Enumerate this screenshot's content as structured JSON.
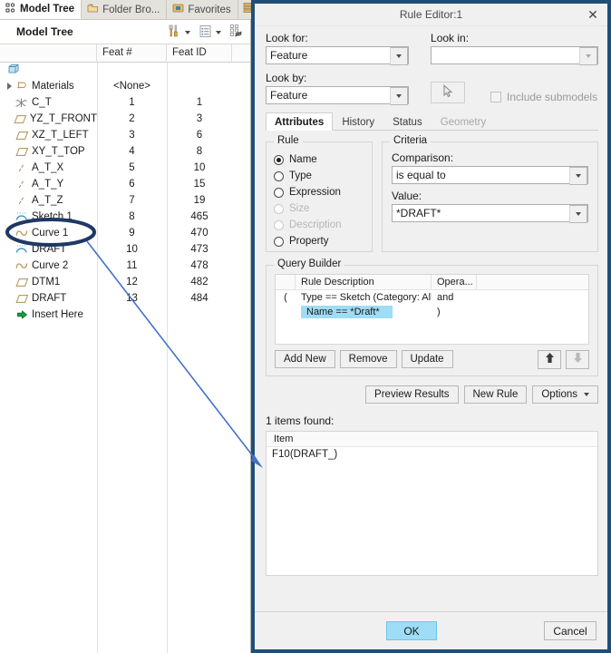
{
  "model_tree": {
    "tabs": [
      {
        "label": "Model Tree",
        "icon": "model-tree-icon",
        "active": true
      },
      {
        "label": "Folder Bro...",
        "icon": "folder-browser-icon",
        "active": false
      },
      {
        "label": "Favorites",
        "icon": "favorites-icon",
        "active": false
      },
      {
        "label": "",
        "icon": "layers-search-icon",
        "active": false
      }
    ],
    "header_title": "Model Tree",
    "toolbar": [
      {
        "name": "settings-tools-icon",
        "has_caret": true
      },
      {
        "name": "tree-filters-icon",
        "has_caret": true
      },
      {
        "name": "show-hide-icon",
        "has_caret": false
      }
    ],
    "columns": [
      "",
      "Feat #",
      "Feat ID",
      ""
    ],
    "rows": [
      {
        "label": "Materials",
        "icon": "materials-icon",
        "feat_num": "<None>",
        "feat_id": "",
        "expander": true,
        "indent": 0
      },
      {
        "label": "C_T",
        "icon": "coordinate-system-icon",
        "feat_num": "1",
        "feat_id": "1",
        "expander": false,
        "indent": 1
      },
      {
        "label": "YZ_T_FRONT",
        "icon": "datum-plane-icon",
        "feat_num": "2",
        "feat_id": "3",
        "expander": false,
        "indent": 1
      },
      {
        "label": "XZ_T_LEFT",
        "icon": "datum-plane-icon",
        "feat_num": "3",
        "feat_id": "6",
        "expander": false,
        "indent": 1
      },
      {
        "label": "XY_T_TOP",
        "icon": "datum-plane-icon",
        "feat_num": "4",
        "feat_id": "8",
        "expander": false,
        "indent": 1
      },
      {
        "label": "A_T_X",
        "icon": "datum-axis-icon",
        "feat_num": "5",
        "feat_id": "10",
        "expander": false,
        "indent": 1
      },
      {
        "label": "A_T_Y",
        "icon": "datum-axis-icon",
        "feat_num": "6",
        "feat_id": "15",
        "expander": false,
        "indent": 1
      },
      {
        "label": "A_T_Z",
        "icon": "datum-axis-icon",
        "feat_num": "7",
        "feat_id": "19",
        "expander": false,
        "indent": 1
      },
      {
        "label": "Sketch 1",
        "icon": "sketch-icon",
        "feat_num": "8",
        "feat_id": "465",
        "expander": false,
        "indent": 1
      },
      {
        "label": "Curve 1",
        "icon": "curve-icon",
        "feat_num": "9",
        "feat_id": "470",
        "expander": false,
        "indent": 1
      },
      {
        "label": "DRAFT",
        "icon": "sketch-icon",
        "feat_num": "10",
        "feat_id": "473",
        "expander": false,
        "indent": 1,
        "highlighted": true
      },
      {
        "label": "Curve 2",
        "icon": "curve-icon",
        "feat_num": "11",
        "feat_id": "478",
        "expander": false,
        "indent": 1
      },
      {
        "label": "DTM1",
        "icon": "datum-plane-icon",
        "feat_num": "12",
        "feat_id": "482",
        "expander": false,
        "indent": 1
      },
      {
        "label": "DRAFT",
        "icon": "datum-plane-icon",
        "feat_num": "13",
        "feat_id": "484",
        "expander": false,
        "indent": 1
      },
      {
        "label": "Insert Here",
        "icon": "insert-here-icon",
        "feat_num": "",
        "feat_id": "",
        "expander": false,
        "indent": 1
      }
    ]
  },
  "rule_editor": {
    "title": "Rule Editor:1",
    "close_label": "✕",
    "look_for": {
      "label": "Look for:",
      "value": "Feature"
    },
    "look_by": {
      "label": "Look by:",
      "value": "Feature"
    },
    "look_in": {
      "label": "Look in:",
      "value": ""
    },
    "pick_button": {
      "name": "pick-cursor-icon"
    },
    "include_submodels": {
      "label": "Include submodels",
      "checked": false
    },
    "tabs": [
      {
        "label": "Attributes",
        "active": true,
        "disabled": false
      },
      {
        "label": "History",
        "active": false,
        "disabled": false
      },
      {
        "label": "Status",
        "active": false,
        "disabled": false
      },
      {
        "label": "Geometry",
        "active": false,
        "disabled": true
      }
    ],
    "rule_group": {
      "legend": "Rule",
      "options": [
        {
          "label": "Name",
          "selected": true,
          "disabled": false
        },
        {
          "label": "Type",
          "selected": false,
          "disabled": false
        },
        {
          "label": "Expression",
          "selected": false,
          "disabled": false
        },
        {
          "label": "Size",
          "selected": false,
          "disabled": true
        },
        {
          "label": "Description",
          "selected": false,
          "disabled": true
        },
        {
          "label": "Property",
          "selected": false,
          "disabled": false
        }
      ]
    },
    "criteria_group": {
      "legend": "Criteria",
      "comparison_label": "Comparison:",
      "comparison_value": "is equal to",
      "value_label": "Value:",
      "value_value": "*DRAFT*"
    },
    "query_builder": {
      "legend": "Query Builder",
      "columns": [
        "",
        "Rule Description",
        "Opera...",
        ""
      ],
      "rows": [
        {
          "paren": "(",
          "description": "Type  ==  Sketch (Category: All)",
          "operator": "and",
          "selected": false
        },
        {
          "paren": "",
          "description": "Name  ==  *Draft*",
          "operator": ")",
          "selected": true
        }
      ],
      "buttons": [
        "Add New",
        "Remove",
        "Update"
      ],
      "move_up_icon": "arrow-up-icon",
      "move_down_icon": "arrow-down-icon"
    },
    "action_buttons": [
      {
        "label": "Preview Results",
        "name": "preview-results-button"
      },
      {
        "label": "New Rule",
        "name": "new-rule-button"
      },
      {
        "label": "Options",
        "name": "options-button",
        "has_caret": true
      }
    ],
    "results": {
      "count_label": "1 items found:",
      "column": "Item",
      "items": [
        "F10(DRAFT_)"
      ]
    },
    "footer": {
      "ok_label": "OK",
      "cancel_label": "Cancel"
    }
  },
  "annotation": {
    "highlight_color": "#1f3864",
    "arrow_color": "#4472c4"
  },
  "colors": {
    "dialog_border": "#1f4e79",
    "selection_blue": "#9fdcf5",
    "panel_bg": "#f0f0f0"
  }
}
